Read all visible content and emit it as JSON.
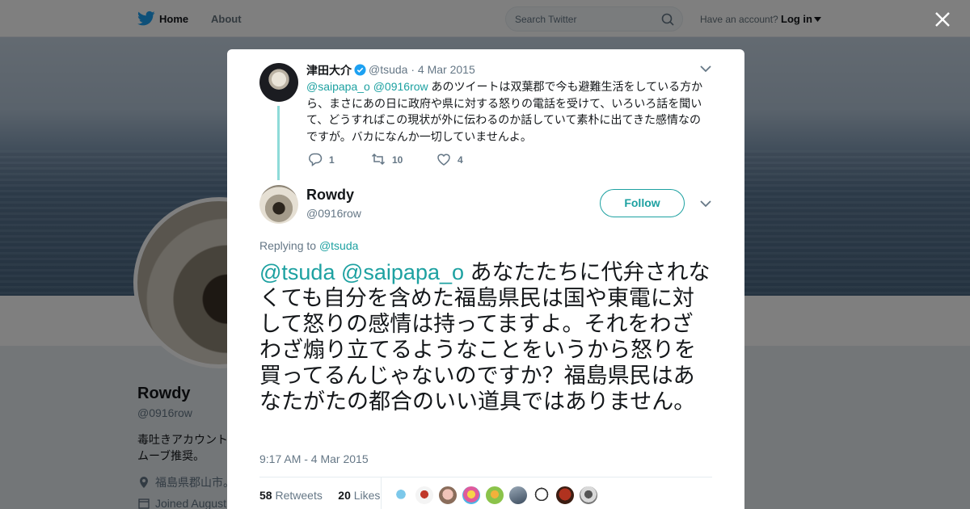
{
  "topbar": {
    "home_label": "Home",
    "about_label": "About",
    "search_placeholder": "Search Twitter",
    "have_account": "Have an account?",
    "login_label": "Log in"
  },
  "profile_bg": {
    "name": "Rowdy",
    "handle": "@0916row",
    "bio_line1": "毒吐きアカウント",
    "bio_line2": "ムーブ推奨。",
    "location": "福島県郡山市。",
    "joined": "Joined August"
  },
  "parent_tweet": {
    "author_name": "津田大介",
    "author_handle": "@tsuda",
    "date_sep": "·",
    "date": "4 Mar 2015",
    "mention1": "@saipapa_o",
    "mention2": "@0916row",
    "body": "あのツイートは双葉郡で今も避難生活をしている方から、まさにあの日に政府や県に対する怒りの電話を受けて、いろいろ話を聞いて、どうすればこの現状が外に伝わるのか話していて素朴に出てきた感情なのですが。バカになんか一切していませんよ。",
    "replies": "1",
    "retweets": "10",
    "likes": "4"
  },
  "main_tweet": {
    "author_name": "Rowdy",
    "author_handle": "@0916row",
    "follow_label": "Follow",
    "replying_prefix": "Replying to",
    "replying_to": "@tsuda",
    "mention1": "@tsuda",
    "mention2": "@saipapa_o",
    "body": "あなたたちに代弁されなくても自分を含めた福島県民は国や東電に対して怒りの感情は持ってますよ。それをわざわざ煽り立てるようなことをいうから怒りを買ってるんじゃないのですか？福島県民はあなたがたの都合のいい道具ではありません。",
    "timestamp": "9:17 AM - 4 Mar 2015",
    "retweets_count": "58",
    "retweets_label": "Retweets",
    "likes_count": "20",
    "likes_label": "Likes"
  },
  "colors": {
    "accent": "#1da1a1",
    "twitter_blue": "#1da1f2",
    "verified": "#1da1f2"
  }
}
